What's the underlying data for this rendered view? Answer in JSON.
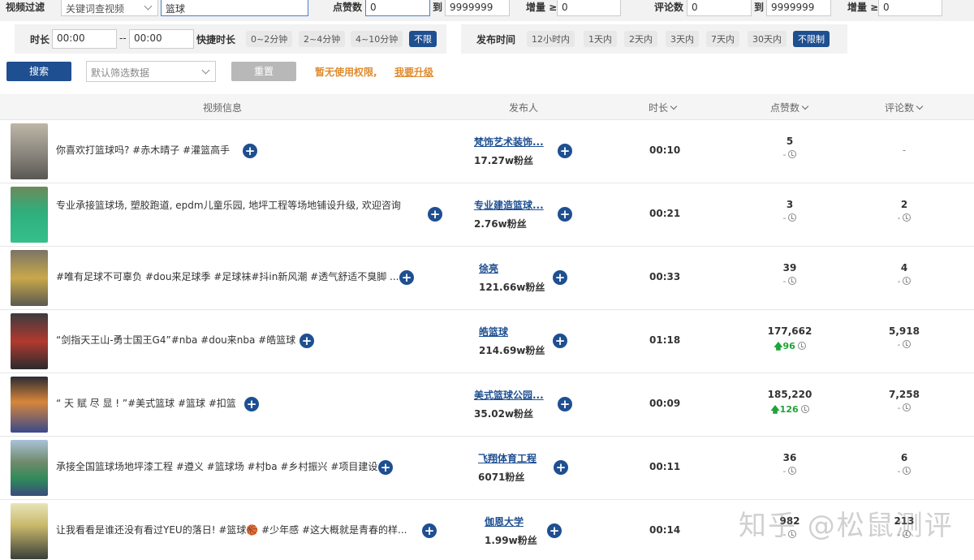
{
  "filters": {
    "video_filter_label": "视频过滤",
    "filter_type_selected": "关键词查视频",
    "keyword_value": "篮球",
    "likes_label": "点赞数",
    "likes_min": "0",
    "likes_to": "到",
    "likes_max": "9999999",
    "likes_inc_label": "增量 ≥",
    "likes_inc_value": "0",
    "comments_label": "评论数",
    "comments_min": "0",
    "comments_to": "到",
    "comments_max": "9999999",
    "comments_inc_label": "增量 ≥",
    "comments_inc_value": "0",
    "duration_label": "时长",
    "duration_from": "00:00",
    "duration_sep": "--",
    "duration_to": "00:00",
    "quick_duration_label": "快捷时长",
    "duration_chips": [
      "0~2分钟",
      "2~4分钟",
      "4~10分钟",
      "不限"
    ],
    "publish_time_label": "发布时间",
    "time_chips": [
      "12小时内",
      "1天内",
      "2天内",
      "3天内",
      "7天内",
      "30天内",
      "不限制"
    ]
  },
  "actions": {
    "search_label": "搜索",
    "default_filter_placeholder": "默认筛选数据",
    "reset_label": "重置",
    "no_permission": "暂无使用权限,",
    "upgrade_label": "我要升级"
  },
  "table": {
    "headers": {
      "video_info": "视频信息",
      "publisher": "发布人",
      "duration": "时长",
      "likes": "点赞数",
      "comments": "评论数"
    },
    "rows": [
      {
        "title": "你喜欢打篮球吗? #赤木晴子 #灌篮高手",
        "publisher": "梵饰艺术装饰...",
        "fans": "17.27w粉丝",
        "duration": "00:10",
        "likes": "5",
        "likes_inc": "-",
        "comments": "-",
        "comments_inc": ""
      },
      {
        "title": "专业承接篮球场, 塑胶跑道, epdm儿童乐园, 地坪工程等场地铺设升级, 欢迎咨询",
        "publisher": "专业建造篮球...",
        "fans": "2.76w粉丝",
        "duration": "00:21",
        "likes": "3",
        "likes_inc": "-",
        "comments": "2",
        "comments_inc": "-"
      },
      {
        "title": "#唯有足球不可辜负 #dou来足球季 #足球袜#抖in新风潮 #透气舒适不臭脚 ...",
        "publisher": "徐亮",
        "fans": "121.66w粉丝",
        "duration": "00:33",
        "likes": "39",
        "likes_inc": "-",
        "comments": "4",
        "comments_inc": "-"
      },
      {
        "title": "“剑指天王山-勇士国王G4”#nba #dou来nba #皓篮球",
        "publisher": "皓篮球",
        "fans": "214.69w粉丝",
        "duration": "01:18",
        "likes": "177,662",
        "likes_inc": "96",
        "comments": "5,918",
        "comments_inc": "-"
      },
      {
        "title": "“ 天 赋 尽 显 ! ”#美式篮球 #篮球 #扣篮",
        "publisher": "美式篮球公园...",
        "fans": "35.02w粉丝",
        "duration": "00:09",
        "likes": "185,220",
        "likes_inc": "126",
        "comments": "7,258",
        "comments_inc": "-"
      },
      {
        "title": "承接全国篮球场地坪漆工程 #遵义 #篮球场 #村ba #乡村振兴 #项目建设",
        "publisher": "飞翔体育工程",
        "fans": "6071粉丝",
        "duration": "00:11",
        "likes": "36",
        "likes_inc": "-",
        "comments": "6",
        "comments_inc": "-"
      },
      {
        "title": "让我看看是谁还没有看过YEU的落日! #篮球🏀 #少年感 #这大概就是青春的样...",
        "publisher": "伽恩大学",
        "fans": "1.99w粉丝",
        "duration": "00:14",
        "likes": "982",
        "likes_inc": "-",
        "comments": "213",
        "comments_inc": "-"
      }
    ]
  },
  "watermark": "知乎 @松鼠测评",
  "colors": {
    "primary": "#1e4f91",
    "warning": "#e08a2d",
    "increase": "#21a33a"
  }
}
